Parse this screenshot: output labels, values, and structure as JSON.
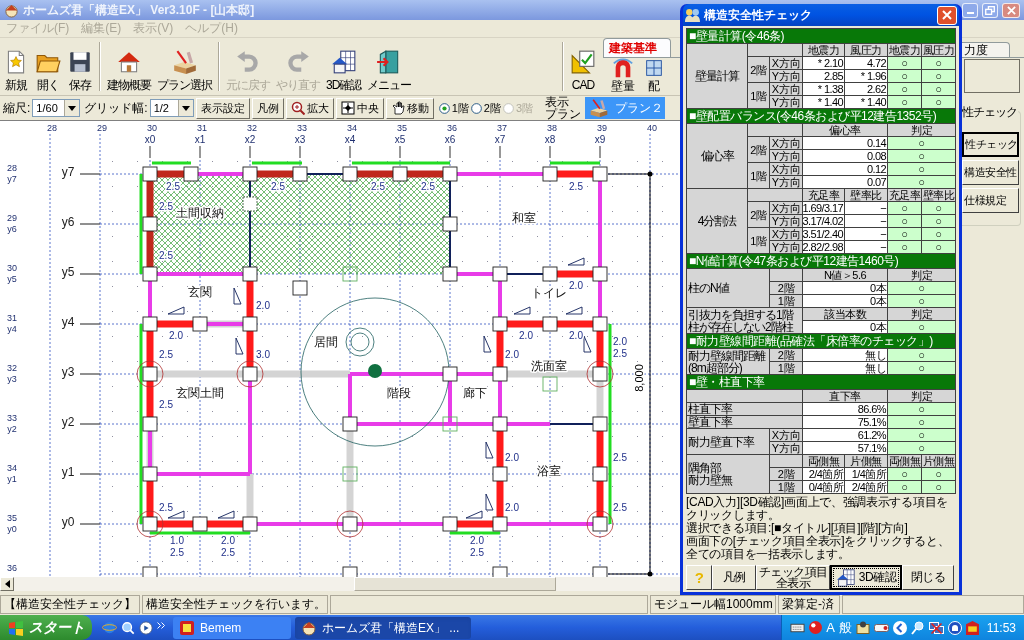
{
  "window": {
    "title": "ホームズ君「構造EX」 Ver3.10F - [山本邸]"
  },
  "menu": [
    {
      "label": "ファイル(F)",
      "disabled": true
    },
    {
      "label": "編集(E)",
      "disabled": true
    },
    {
      "label": "表示(V)",
      "disabled": true
    },
    {
      "label": "ヘルプ(H)",
      "disabled": true
    }
  ],
  "toolbar": {
    "groups": [
      [
        {
          "label": "新規",
          "disabled": false
        },
        {
          "label": "開く",
          "disabled": false
        },
        {
          "label": "保存",
          "disabled": false
        }
      ],
      [
        {
          "label": "建物概要",
          "disabled": false
        },
        {
          "label": "プラン選択",
          "disabled": false
        }
      ],
      [
        {
          "label": "元に戻す",
          "disabled": true
        },
        {
          "label": "やり直す",
          "disabled": true
        },
        {
          "label": "3D確認",
          "disabled": false
        },
        {
          "label": "メニュー",
          "disabled": false
        }
      ],
      [
        {
          "label": "CAD",
          "disabled": false
        }
      ]
    ]
  },
  "tabs": [
    {
      "label": "建築基準",
      "selected": true,
      "items": [
        "壁量",
        "配"
      ]
    },
    {
      "label": "力度",
      "selected": false
    }
  ],
  "view_bar": {
    "scale_label": "縮尺:",
    "scale": "1/60",
    "grid_label": "グリッド幅:",
    "grid": "1/2",
    "buttons": [
      "表示設定",
      "凡例",
      "拡大",
      "中央",
      "移動"
    ],
    "floors": [
      {
        "label": "1階",
        "selected": true,
        "disabled": false
      },
      {
        "label": "2階",
        "selected": false,
        "disabled": false
      },
      {
        "label": "3階",
        "selected": false,
        "disabled": true
      }
    ],
    "plan_label": [
      "表示",
      "プラン"
    ],
    "plan": "プラン２"
  },
  "plan": {
    "top_ruler": [
      "28",
      "29",
      "30",
      "31",
      "32",
      "33",
      "34",
      "35",
      "36",
      "37",
      "38",
      "39",
      "40"
    ],
    "x_axes": [
      "x0",
      "x1",
      "x2",
      "x3",
      "x4",
      "x5",
      "x6",
      "x7",
      "x8",
      "x9"
    ],
    "left_ruler": [
      "28",
      "29",
      "30",
      "31",
      "32",
      "33",
      "34",
      "35",
      "36"
    ],
    "left_axes": [
      "y7",
      "y6",
      "y5",
      "y4",
      "y3",
      "y2",
      "y1",
      "y0"
    ],
    "y_axes": [
      "y7",
      "y6",
      "y5",
      "y4",
      "y3",
      "y2",
      "y1",
      "y0"
    ],
    "rooms": [
      "土間収納",
      "和室",
      "玄関",
      "トイレ",
      "居間",
      "洗面室",
      "玄関土間",
      "階段",
      "廊下",
      "浴室"
    ],
    "wall_values": [
      "2.5",
      "2.5",
      "2.5",
      "2.5",
      "2.5",
      "2.5",
      "2.5",
      "2.0",
      "2.0",
      "2.0",
      "2.0",
      "2.0",
      "2.5",
      "3.0",
      "2.0",
      "2.0",
      "2.5",
      "2.5",
      "2.0",
      "2.5",
      "2.5",
      "2.0",
      "2.5",
      "1.0",
      "2.5",
      "2.0",
      "2.5",
      "2.0",
      "2.5"
    ],
    "dimension": "8,000"
  },
  "side": {
    "group": "性チェック",
    "buttons": [
      {
        "label": "性チェック",
        "selected": true
      },
      {
        "label": "構造安全性",
        "selected": false
      },
      {
        "label": "仕様規定",
        "selected": false
      }
    ]
  },
  "check_panel": {
    "title": "構造安全性チェック",
    "sections": [
      {
        "title": "■壁量計算(令46条)",
        "blocks": [
          {
            "label": [
              "壁量計算"
            ],
            "columns": [
              "地震力",
              "風圧力",
              "地震力",
              "風圧力"
            ],
            "groups": [
              {
                "floor": "2階",
                "rows": [
                  {
                    "dir": "X方向",
                    "values": [
                      "* 2.10",
                      "4.72"
                    ],
                    "results": [
                      "○",
                      "○"
                    ]
                  },
                  {
                    "dir": "Y方向",
                    "values": [
                      "2.85",
                      "* 1.96"
                    ],
                    "results": [
                      "○",
                      "○"
                    ]
                  }
                ]
              },
              {
                "floor": "1階",
                "rows": [
                  {
                    "dir": "X方向",
                    "values": [
                      "* 1.38",
                      "2.62"
                    ],
                    "results": [
                      "○",
                      "○"
                    ]
                  },
                  {
                    "dir": "Y方向",
                    "values": [
                      "* 1.40",
                      "* 1.40"
                    ],
                    "results": [
                      "○",
                      "○"
                    ]
                  }
                ]
              }
            ]
          }
        ]
      },
      {
        "title": "■壁配置バランス(令46条および平12建告1352号)",
        "blocks": [
          {
            "label": [
              "偏心率"
            ],
            "columns": [
              "偏心率",
              "判定"
            ],
            "groups": [
              {
                "floor": "2階",
                "rows": [
                  {
                    "dir": "X方向",
                    "values": [
                      "0.14"
                    ],
                    "results": [
                      "○"
                    ]
                  },
                  {
                    "dir": "Y方向",
                    "values": [
                      "0.08"
                    ],
                    "results": [
                      "○"
                    ]
                  }
                ]
              },
              {
                "floor": "1階",
                "rows": [
                  {
                    "dir": "X方向",
                    "values": [
                      "0.12"
                    ],
                    "results": [
                      "○"
                    ]
                  },
                  {
                    "dir": "Y方向",
                    "values": [
                      "0.07"
                    ],
                    "results": [
                      "○"
                    ]
                  }
                ]
              }
            ]
          },
          {
            "label": [
              "4分割法"
            ],
            "columns": [
              "充足率",
              "壁率比",
              "充足率",
              "壁率比"
            ],
            "groups": [
              {
                "floor": "2階",
                "rows": [
                  {
                    "dir": "X方向",
                    "values": [
                      "1.69/3.17",
                      "−"
                    ],
                    "results": [
                      "○",
                      "○"
                    ]
                  },
                  {
                    "dir": "Y方向",
                    "values": [
                      "3.17/4.02",
                      "−"
                    ],
                    "results": [
                      "○",
                      "○"
                    ]
                  }
                ]
              },
              {
                "floor": "1階",
                "rows": [
                  {
                    "dir": "X方向",
                    "values": [
                      "3.51/2.40",
                      "−"
                    ],
                    "results": [
                      "○",
                      "○"
                    ]
                  },
                  {
                    "dir": "Y方向",
                    "values": [
                      "2.82/2.98",
                      "−"
                    ],
                    "results": [
                      "○",
                      "○"
                    ]
                  }
                ]
              }
            ]
          }
        ]
      },
      {
        "title": "■N値計算(令47条および平12建告1460号)",
        "blocks": [
          {
            "label": [
              "柱のN値"
            ],
            "columns": [
              "N値＞5.6",
              "判定"
            ],
            "rows": [
              {
                "key": "2階",
                "values": [
                  "0本"
                ],
                "results": [
                  "○"
                ]
              },
              {
                "key": "1階",
                "values": [
                  "0本"
                ],
                "results": [
                  "○"
                ]
              }
            ]
          },
          {
            "label": [
              "引抜力を負担する1階",
              "柱が存在しない2階柱"
            ],
            "columns": [
              "該当本数",
              "判定"
            ],
            "rows": [
              {
                "values": [
                  "0本"
                ],
                "results": [
                  "○"
                ]
              }
            ]
          }
        ]
      },
      {
        "title": "■耐力壁線間距離(品確法「床倍率のチェック」)",
        "blocks": [
          {
            "label": [
              "耐力壁線間距離",
              "(8m超部分)"
            ],
            "rows": [
              {
                "key": "2階",
                "values": [
                  "無し"
                ],
                "results": [
                  "○"
                ]
              },
              {
                "key": "1階",
                "values": [
                  "無し"
                ],
                "results": [
                  "○"
                ]
              }
            ]
          }
        ]
      },
      {
        "title": "■壁・柱直下率",
        "blocks": [
          {
            "columns": [
              "直下率",
              "判定"
            ]
          },
          {
            "label": [
              "柱直下率"
            ],
            "rows": [
              {
                "values": [
                  "86.6%"
                ],
                "results": [
                  "○"
                ]
              }
            ]
          },
          {
            "label": [
              "壁直下率"
            ],
            "rows": [
              {
                "values": [
                  "75.1%"
                ],
                "results": [
                  "○"
                ]
              }
            ]
          },
          {
            "label": [
              "耐力壁直下率"
            ],
            "rows": [
              {
                "key": "X方向",
                "values": [
                  "61.2%"
                ],
                "results": [
                  "○"
                ]
              },
              {
                "key": "Y方向",
                "values": [
                  "57.1%"
                ],
                "results": [
                  "○"
                ]
              }
            ]
          },
          {
            "label": [
              "隅角部",
              "耐力壁無"
            ],
            "columns": [
              "両側無",
              "片側無",
              "両側無",
              "片側無"
            ],
            "rows": [
              {
                "key": "2階",
                "values": [
                  "2/4箇所",
                  "1/4箇所"
                ],
                "results": [
                  "○",
                  "○"
                ]
              },
              {
                "key": "1階",
                "values": [
                  "0/4箇所",
                  "2/4箇所"
                ],
                "results": [
                  "○",
                  "○"
                ]
              }
            ]
          }
        ]
      }
    ],
    "note": [
      "[CAD入力][3D確認]画面上で、強調表示する項目をクリックします。",
      "選択できる項目:[■タイトル][項目][階][方向]",
      "画面下の[チェック項目全表示]をクリックすると、全ての項目を一括表示します。"
    ],
    "buttons": [
      {
        "label": "?",
        "default": false
      },
      {
        "label": "凡例",
        "default": false
      },
      {
        "label": "チェック項目全表示",
        "default": false
      },
      {
        "label": "3D確認",
        "default": true
      },
      {
        "label": "閉じる",
        "default": false
      }
    ]
  },
  "status_bar": [
    "【構造安全性チェック】",
    "構造安全性チェックを行います。",
    "モジュール幅1000mm",
    "梁算定-済"
  ],
  "taskbar": {
    "start": "スタート",
    "tasks": [
      {
        "label": "Bemem",
        "selected": false
      },
      {
        "label": "ホームズ君「構造EX」 ...",
        "selected": true
      }
    ],
    "ime": [
      "A",
      "般"
    ],
    "clock": "11:53"
  }
}
